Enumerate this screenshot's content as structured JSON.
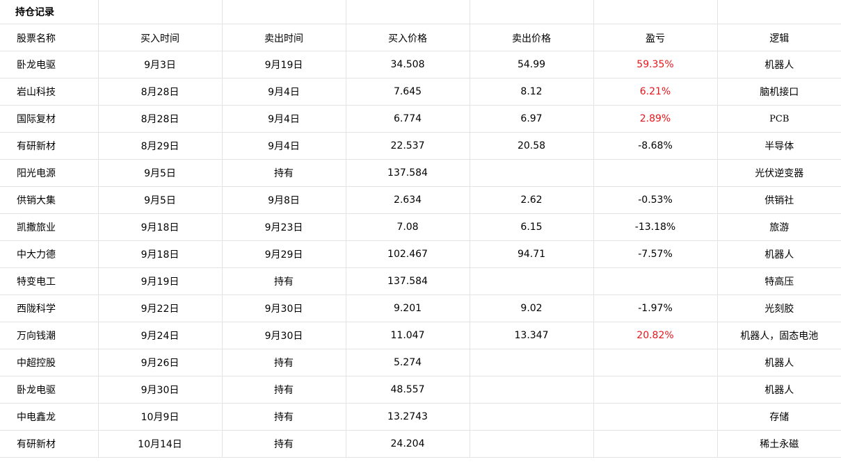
{
  "sheet": {
    "title": "持仓记录",
    "columns": [
      "股票名称",
      "买入时间",
      "卖出时间",
      "买入价格",
      "卖出价格",
      "盈亏",
      "逻辑"
    ],
    "colors": {
      "profit": "#e8141b",
      "text": "#000000",
      "grid": "#e3e3e3"
    },
    "rows": [
      {
        "name": "卧龙电驱",
        "buy_date": "9月3日",
        "sell_date": "9月19日",
        "buy_price": "34.508",
        "sell_price": "54.99",
        "pnl": "59.35%",
        "positive": true,
        "logic": "机器人"
      },
      {
        "name": "岩山科技",
        "buy_date": "8月28日",
        "sell_date": "9月4日",
        "buy_price": "7.645",
        "sell_price": "8.12",
        "pnl": "6.21%",
        "positive": true,
        "logic": "脑机接口"
      },
      {
        "name": "国际复材",
        "buy_date": "8月28日",
        "sell_date": "9月4日",
        "buy_price": "6.774",
        "sell_price": "6.97",
        "pnl": "2.89%",
        "positive": true,
        "logic": "PCB"
      },
      {
        "name": "有研新材",
        "buy_date": "8月29日",
        "sell_date": "9月4日",
        "buy_price": "22.537",
        "sell_price": "20.58",
        "pnl": "-8.68%",
        "positive": false,
        "logic": "半导体"
      },
      {
        "name": "阳光电源",
        "buy_date": "9月5日",
        "sell_date": "持有",
        "buy_price": "137.584",
        "sell_price": "",
        "pnl": "",
        "positive": false,
        "logic": "光伏逆变器"
      },
      {
        "name": "供销大集",
        "buy_date": "9月5日",
        "sell_date": "9月8日",
        "buy_price": "2.634",
        "sell_price": "2.62",
        "pnl": "-0.53%",
        "positive": false,
        "logic": "供销社"
      },
      {
        "name": "凯撒旅业",
        "buy_date": "9月18日",
        "sell_date": "9月23日",
        "buy_price": "7.08",
        "sell_price": "6.15",
        "pnl": "-13.18%",
        "positive": false,
        "logic": "旅游"
      },
      {
        "name": "中大力德",
        "buy_date": "9月18日",
        "sell_date": "9月29日",
        "buy_price": "102.467",
        "sell_price": "94.71",
        "pnl": "-7.57%",
        "positive": false,
        "logic": "机器人"
      },
      {
        "name": "特变电工",
        "buy_date": "9月19日",
        "sell_date": "持有",
        "buy_price": "137.584",
        "sell_price": "",
        "pnl": "",
        "positive": false,
        "logic": "特高压"
      },
      {
        "name": "西陇科学",
        "buy_date": "9月22日",
        "sell_date": "9月30日",
        "buy_price": "9.201",
        "sell_price": "9.02",
        "pnl": "-1.97%",
        "positive": false,
        "logic": "光刻胶"
      },
      {
        "name": "万向钱潮",
        "buy_date": "9月24日",
        "sell_date": "9月30日",
        "buy_price": "11.047",
        "sell_price": "13.347",
        "pnl": "20.82%",
        "positive": true,
        "logic": "机器人，固态电池"
      },
      {
        "name": "中超控股",
        "buy_date": "9月26日",
        "sell_date": "持有",
        "buy_price": "5.274",
        "sell_price": "",
        "pnl": "",
        "positive": false,
        "logic": "机器人"
      },
      {
        "name": "卧龙电驱",
        "buy_date": "9月30日",
        "sell_date": "持有",
        "buy_price": "48.557",
        "sell_price": "",
        "pnl": "",
        "positive": false,
        "logic": "机器人"
      },
      {
        "name": "中电鑫龙",
        "buy_date": "10月9日",
        "sell_date": "持有",
        "buy_price": "13.2743",
        "sell_price": "",
        "pnl": "",
        "positive": false,
        "logic": "存储"
      },
      {
        "name": "有研新材",
        "buy_date": "10月14日",
        "sell_date": "持有",
        "buy_price": "24.204",
        "sell_price": "",
        "pnl": "",
        "positive": false,
        "logic": "稀土永磁"
      }
    ]
  }
}
